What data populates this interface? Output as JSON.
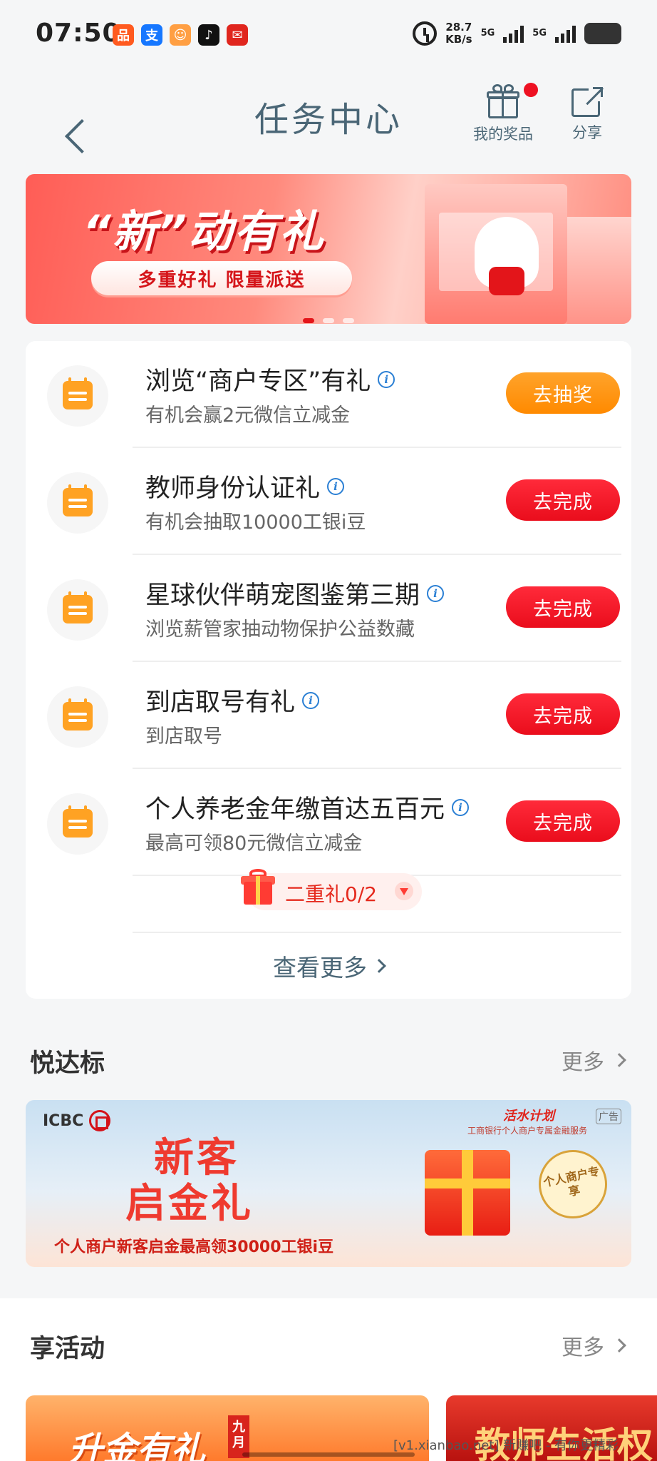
{
  "status_bar": {
    "time": "07:50",
    "app_icons": [
      {
        "name": "taobao-app-icon",
        "glyph": "品",
        "color": "#ff5a1f"
      },
      {
        "name": "alipay-app-icon",
        "glyph": "支",
        "color": "#1677ff"
      },
      {
        "name": "game-app-icon",
        "glyph": "☺",
        "color": "#ff9f43"
      },
      {
        "name": "tiktok-app-icon",
        "glyph": "♪",
        "color": "#111111"
      },
      {
        "name": "news-app-icon",
        "glyph": "✉",
        "color": "#e0261e"
      }
    ],
    "net_speed_value": "28.7",
    "net_speed_unit": "KB/s",
    "sim1": "5G",
    "sim2": "5G"
  },
  "header": {
    "title": "任务中心",
    "my_prizes_label": "我的奖品",
    "share_label": "分享"
  },
  "banner": {
    "title": "“新”动有礼",
    "subtitle": "多重好礼 限量派送",
    "dots": 3,
    "active_dot": 0
  },
  "tasks": [
    {
      "title": "浏览“商户专区”有礼",
      "subtitle": "有机会赢2元微信立减金",
      "button": "去抽奖",
      "button_style": "orange"
    },
    {
      "title": "教师身份认证礼",
      "subtitle": "有机会抽取10000工银i豆",
      "button": "去完成",
      "button_style": "red"
    },
    {
      "title": "星球伙伴萌宠图鉴第三期",
      "subtitle": "浏览薪管家抽动物保护公益数藏",
      "button": "去完成",
      "button_style": "red"
    },
    {
      "title": "到店取号有礼",
      "subtitle": "到店取号",
      "button": "去完成",
      "button_style": "red"
    },
    {
      "title": "个人养老金年缴首达五百元",
      "subtitle": "最高可领80元微信立减金",
      "button": "去完成",
      "button_style": "red"
    }
  ],
  "reward_progress": {
    "label": "二重礼0/2"
  },
  "see_more": "查看更多",
  "section_yuedabiao": {
    "title": "悦达标",
    "more": "更多"
  },
  "ad": {
    "brand": "ICBC",
    "plan": "活水计划",
    "plan_sub": "工商银行个人商户专属金融服务",
    "tag": "广告",
    "title_line1": "新客",
    "title_line2": "启金礼",
    "subtitle": "个人商户新客启金最高领30000工银i豆",
    "seal": "个人商户专享"
  },
  "section_activities": {
    "title": "享活动",
    "more": "更多"
  },
  "activities": [
    {
      "title": "升金有礼",
      "badge": "九月"
    },
    {
      "title": "教师生活权"
    }
  ],
  "watermark": "[v1.xianbao.net] 新赚吧 - 有你更精彩"
}
